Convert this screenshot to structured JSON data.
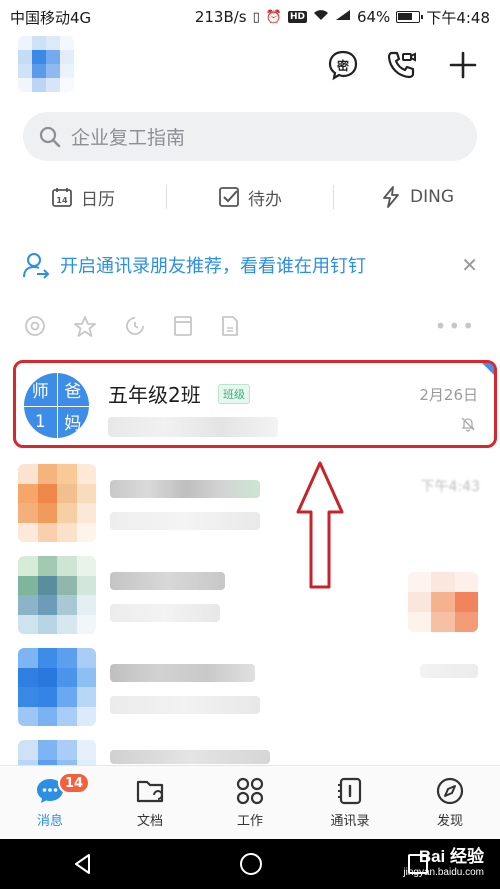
{
  "status_bar": {
    "carrier": "中国移动4G",
    "speed": "213B/s",
    "network": "4G",
    "battery": "64%",
    "time": "下午4:48"
  },
  "header": {
    "icons": [
      "secret-chat-icon",
      "phone-call-icon",
      "plus-icon"
    ],
    "secret_label": "密"
  },
  "search": {
    "placeholder": "企业复工指南"
  },
  "quick_actions": [
    {
      "label": "日历",
      "icon": "calendar-icon",
      "badge": "14"
    },
    {
      "label": "待办",
      "icon": "todo-icon"
    },
    {
      "label": "DING",
      "icon": "ding-icon"
    }
  ],
  "banner": {
    "text": "开启通讯录朋友推荐，看看谁在用钉钉",
    "icon": "contact-recommend-icon"
  },
  "filters": [
    "at-icon",
    "star-icon",
    "clock-icon",
    "bookmark-icon",
    "document-icon"
  ],
  "chat_pinned": {
    "name": "五年级2班",
    "tag": "班级",
    "date": "2月26日",
    "avatar_cells": [
      "师",
      "爸",
      "1",
      "妈"
    ]
  },
  "chats_other": [
    {
      "time": "下午4:43"
    }
  ],
  "tab_bar": [
    {
      "label": "消息",
      "icon": "message-icon",
      "badge": "14",
      "active": true
    },
    {
      "label": "文档",
      "icon": "folder-icon"
    },
    {
      "label": "工作",
      "icon": "apps-grid-icon"
    },
    {
      "label": "通讯录",
      "icon": "contacts-icon"
    },
    {
      "label": "发现",
      "icon": "compass-icon"
    }
  ],
  "watermark": {
    "brand": "Bai 经验",
    "url": "jingyan.baidu.com"
  },
  "colors": {
    "accent": "#2b8fe6",
    "highlight_border": "#d9272e",
    "badge": "#f5603c"
  }
}
